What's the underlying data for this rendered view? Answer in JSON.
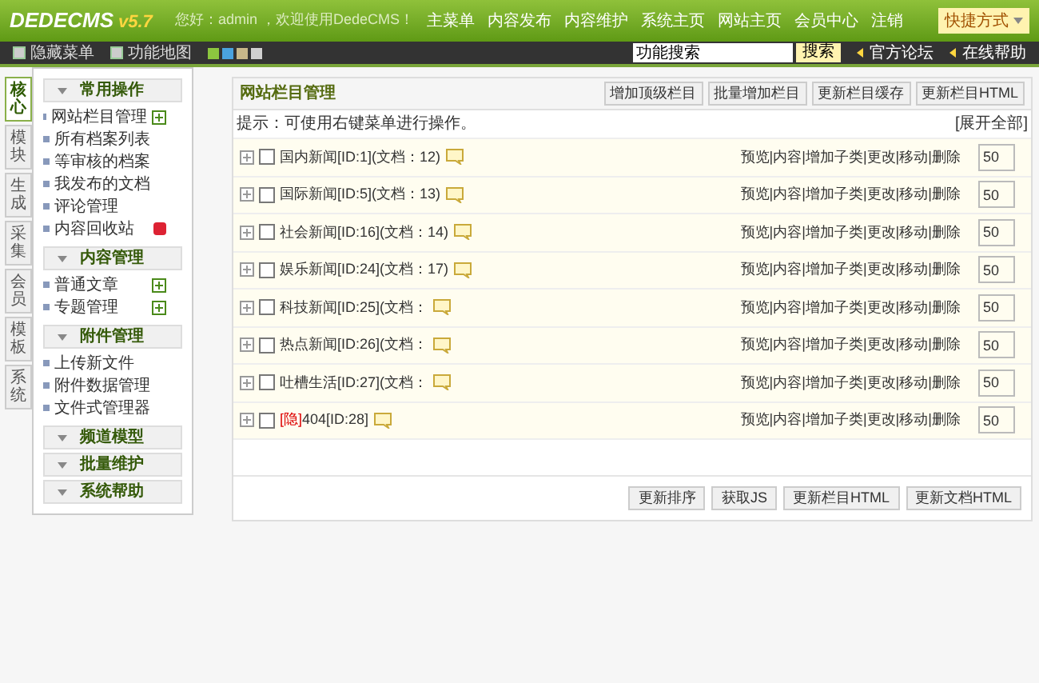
{
  "header": {
    "logo": "DEDECMS",
    "version": "v5.7",
    "greeting": "您好：admin ，欢迎使用DedeCMS！",
    "nav": [
      "主菜单",
      "内容发布",
      "内容维护",
      "系统主页",
      "网站主页",
      "会员中心",
      "注销"
    ],
    "shortcut": "快捷方式"
  },
  "toolbar": {
    "left": [
      "隐藏菜单",
      "功能地图"
    ],
    "themes": [
      {
        "color": "#8cc63f"
      },
      {
        "color": "#4aa3df"
      },
      {
        "color": "#c8b88a"
      },
      {
        "color": "#d0d0d0"
      }
    ],
    "search": {
      "value": "功能搜索",
      "button": "搜索"
    },
    "links": [
      "官方论坛",
      "在线帮助"
    ]
  },
  "side_tabs": [
    {
      "label": "核心",
      "selected": true
    },
    {
      "label": "模块",
      "selected": false
    },
    {
      "label": "生成",
      "selected": false
    },
    {
      "label": "采集",
      "selected": false
    },
    {
      "label": "会员",
      "selected": false
    },
    {
      "label": "模板",
      "selected": false
    },
    {
      "label": "系统",
      "selected": false
    }
  ],
  "menu": [
    {
      "title": "常用操作",
      "items": [
        {
          "label": "网站栏目管理",
          "kind": "add"
        },
        {
          "label": "所有档案列表",
          "kind": "plain"
        },
        {
          "label": "等审核的档案",
          "kind": "plain"
        },
        {
          "label": "我发布的文档",
          "kind": "plain"
        },
        {
          "label": "评论管理",
          "kind": "plain"
        },
        {
          "label": "内容回收站",
          "kind": "trash"
        }
      ]
    },
    {
      "title": "内容管理",
      "items": [
        {
          "label": "普通文章",
          "kind": "add"
        },
        {
          "label": "专题管理",
          "kind": "add"
        }
      ]
    },
    {
      "title": "附件管理",
      "items": [
        {
          "label": "上传新文件",
          "kind": "plain"
        },
        {
          "label": "附件数据管理",
          "kind": "plain"
        },
        {
          "label": "文件式管理器",
          "kind": "plain"
        }
      ]
    },
    {
      "title": "频道模型"
    },
    {
      "title": "批量维护"
    },
    {
      "title": "系统帮助"
    }
  ],
  "panel": {
    "title": "网站栏目管理",
    "buttons": [
      "增加顶级栏目",
      "批量增加栏目",
      "更新栏目缓存",
      "更新栏目HTML"
    ],
    "hint": "提示：可使用右键菜单进行操作。",
    "expand_all": "[展开全部]",
    "rows": [
      {
        "name": "国内新闻[ID:1](文档：12)",
        "checked": false,
        "actions": "预览|内容|增加子类|更改|移动|删除",
        "sort": "50"
      },
      {
        "name": "国际新闻[ID:5](文档：13)",
        "checked": false,
        "actions": "预览|内容|增加子类|更改|移动|删除",
        "sort": "50"
      },
      {
        "name": "社会新闻[ID:16](文档：14)",
        "checked": false,
        "actions": "预览|内容|增加子类|更改|移动|删除",
        "sort": "50"
      },
      {
        "name": "娱乐新闻[ID:24](文档：17)",
        "checked": false,
        "actions": "预览|内容|增加子类|更改|移动|删除",
        "sort": "50"
      },
      {
        "name": "科技新闻[ID:25](文档：",
        "checked": false,
        "actions": "预览|内容|增加子类|更改|移动|删除",
        "sort": "50"
      },
      {
        "name": "热点新闻[ID:26](文档：",
        "checked": false,
        "actions": "预览|内容|增加子类|更改|移动|删除",
        "sort": "50"
      },
      {
        "name": "吐槽生活[ID:27](文档：",
        "checked": false,
        "actions": "预览|内容|增加子类|更改|移动|删除",
        "sort": "50"
      },
      {
        "prefix": "[隐]",
        "name": "404[ID:28]",
        "checked": false,
        "actions": "预览|内容|增加子类|更改|移动|删除",
        "sort": "50"
      }
    ],
    "footer_buttons": [
      "更新排序",
      "获取JS",
      "更新栏目HTML",
      "更新文档HTML"
    ]
  }
}
